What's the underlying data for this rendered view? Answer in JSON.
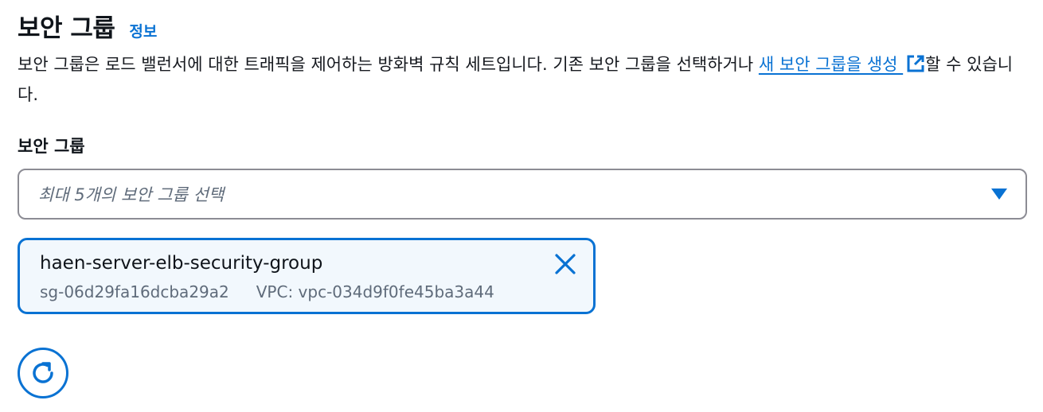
{
  "header": {
    "title": "보안 그룹",
    "info_link": "정보"
  },
  "description": {
    "text_before": "보안 그룹은 로드 밸런서에 대한 트래픽을 제어하는 방화벽 규칙 세트입니다. 기존 보안 그룹을 선택하거나 ",
    "link_text": "새 보안 그룹을 생성",
    "text_after": "할 수 있습니다.",
    "link_icon": "external-link-icon"
  },
  "security_group_field": {
    "label": "보안 그룹",
    "placeholder": "최대 5개의 보안 그룹 선택",
    "caret_icon": "caret-down-icon"
  },
  "selected_tokens": [
    {
      "name": "haen-server-elb-security-group",
      "id": "sg-06d29fa16dcba29a2",
      "vpc": "VPC: vpc-034d9f0fe45ba3a44",
      "dismiss_icon": "close-icon"
    }
  ],
  "refresh": {
    "icon": "refresh-icon"
  },
  "colors": {
    "accent": "#0972d3",
    "text": "#16191f",
    "secondary_text": "#5f6b7a",
    "border": "#8c8c94",
    "token_bg": "#f2f8fd"
  }
}
